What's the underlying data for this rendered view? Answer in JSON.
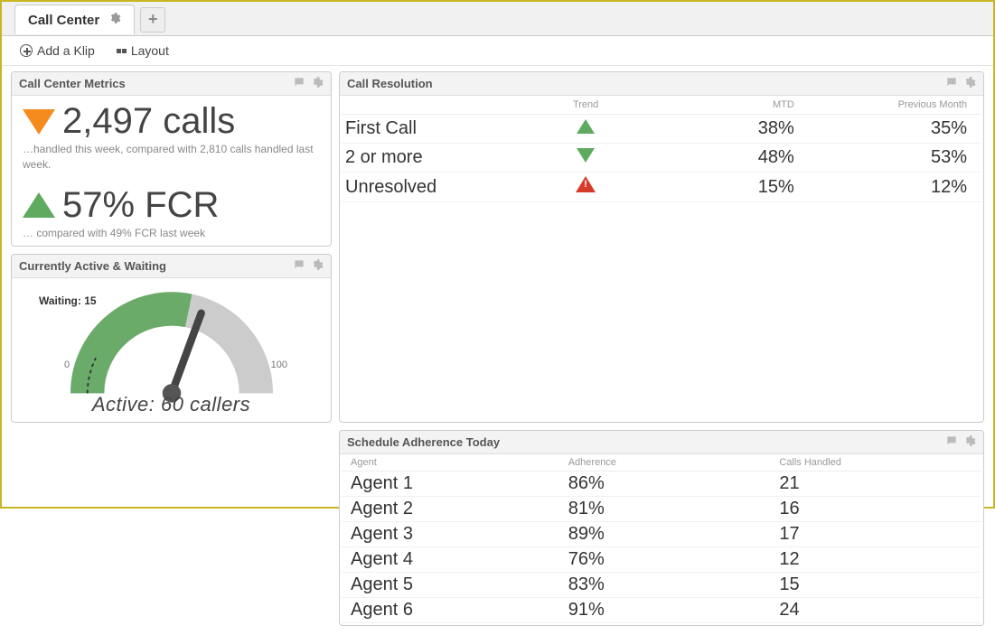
{
  "tabs": {
    "active": "Call Center"
  },
  "toolbar": {
    "add_klip": "Add a Klip",
    "layout": "Layout"
  },
  "metrics_panel": {
    "title": "Call Center Metrics",
    "calls_value": "2,497 calls",
    "calls_sub": "…handled this week, compared with 2,810 calls handled last week.",
    "fcr_value": "57% FCR",
    "fcr_sub": "… compared with 49% FCR last week"
  },
  "active_panel": {
    "title": "Currently Active & Waiting",
    "waiting_label": "Waiting: 15",
    "tick_min": "0",
    "tick_max": "100",
    "active_label": "Active: 60 callers"
  },
  "resolution_panel": {
    "title": "Call Resolution",
    "headers": {
      "trend": "Trend",
      "mtd": "MTD",
      "prev": "Previous Month"
    },
    "rows": [
      {
        "label": "First Call",
        "trend": "up",
        "mtd": "38%",
        "prev": "35%"
      },
      {
        "label": "2 or more",
        "trend": "down",
        "mtd": "48%",
        "prev": "53%"
      },
      {
        "label": "Unresolved",
        "trend": "alert",
        "mtd": "15%",
        "prev": "12%"
      }
    ]
  },
  "schedule_panel": {
    "title": "Schedule Adherence Today",
    "headers": {
      "agent": "Agent",
      "adh": "Adherence",
      "calls": "Calls Handled"
    },
    "rows": [
      {
        "agent": "Agent 1",
        "adh": "86%",
        "adh_color": "green",
        "calls": "21"
      },
      {
        "agent": "Agent 2",
        "adh": "81%",
        "adh_color": "red",
        "calls": "16"
      },
      {
        "agent": "Agent 3",
        "adh": "89%",
        "adh_color": "green",
        "calls": "17"
      },
      {
        "agent": "Agent 4",
        "adh": "76%",
        "adh_color": "red",
        "calls": "12"
      },
      {
        "agent": "Agent 5",
        "adh": "83%",
        "adh_color": "red",
        "calls": "15"
      },
      {
        "agent": "Agent 6",
        "adh": "91%",
        "adh_color": "green",
        "calls": "24"
      }
    ]
  },
  "chart_data": {
    "type": "gauge",
    "title": "Currently Active & Waiting",
    "min": 0,
    "max": 100,
    "value": 60,
    "secondary_label": "Waiting",
    "secondary_value": 15,
    "green_zone": [
      0,
      55
    ]
  }
}
